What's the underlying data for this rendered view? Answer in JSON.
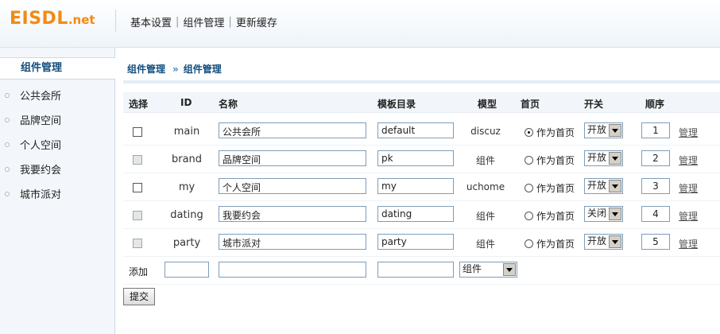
{
  "logo": {
    "main": "EISDL",
    "dot": ".",
    "tld": "net"
  },
  "topnav": [
    "基本设置",
    "组件管理",
    "更新缓存"
  ],
  "sidebar": {
    "title": "组件管理",
    "items": [
      "公共会所",
      "品牌空间",
      "个人空间",
      "我要约会",
      "城市派对"
    ]
  },
  "breadcrumb": {
    "parent": "组件管理",
    "arrow": "»",
    "current": "组件管理"
  },
  "table": {
    "headers": {
      "select": "选择",
      "id": "ID",
      "name": "名称",
      "template": "模板目录",
      "model": "模型",
      "home": "首页",
      "switch": "开关",
      "order": "顺序"
    },
    "rows": [
      {
        "id": "main",
        "name": "公共会所",
        "template": "default",
        "model": "discuz",
        "home_label": "作为首页",
        "home_selected": true,
        "switch": "开放",
        "order": "1",
        "manage": "管理",
        "checkbox_disabled": false
      },
      {
        "id": "brand",
        "name": "品牌空间",
        "template": "pk",
        "model": "组件",
        "home_label": "作为首页",
        "home_selected": false,
        "switch": "开放",
        "order": "2",
        "manage": "管理",
        "checkbox_disabled": true
      },
      {
        "id": "my",
        "name": "个人空间",
        "template": "my",
        "model": "uchome",
        "home_label": "作为首页",
        "home_selected": false,
        "switch": "开放",
        "order": "3",
        "manage": "管理",
        "checkbox_disabled": false
      },
      {
        "id": "dating",
        "name": "我要约会",
        "template": "dating",
        "model": "组件",
        "home_label": "作为首页",
        "home_selected": false,
        "switch": "关闭",
        "order": "4",
        "manage": "管理",
        "checkbox_disabled": true
      },
      {
        "id": "party",
        "name": "城市派对",
        "template": "party",
        "model": "组件",
        "home_label": "作为首页",
        "home_selected": false,
        "switch": "开放",
        "order": "5",
        "manage": "管理",
        "checkbox_disabled": true
      }
    ],
    "add": {
      "label": "添加",
      "model_select": "组件"
    }
  },
  "submit_label": "提交"
}
